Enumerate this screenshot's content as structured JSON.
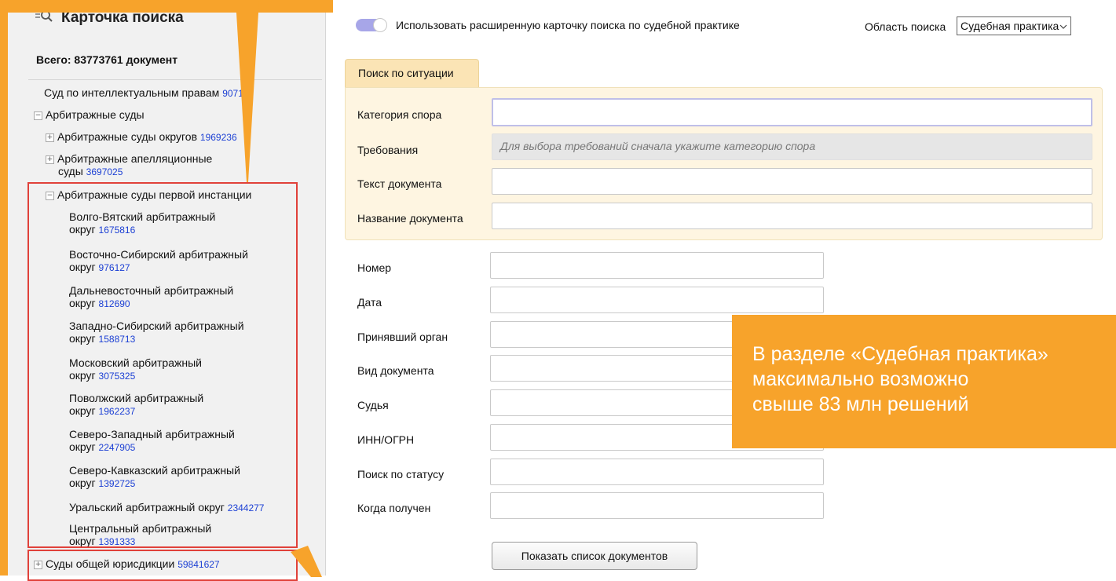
{
  "sidebar": {
    "title": "Карточка поиска",
    "total": "Всего: 83773761 документ",
    "items": [
      {
        "label": "Суд по интеллектуальным правам",
        "count": "90712"
      },
      {
        "label": "Арбитражные суды",
        "count": ""
      },
      {
        "label": "Арбитражные суды округов",
        "count": "1969236"
      },
      {
        "label": "Арбитражные апелляционные",
        "label2": "суды",
        "count": "3697025"
      },
      {
        "label": "Арбитражные суды первой инстанции",
        "count": ""
      },
      {
        "label": "Волго-Вятский арбитражный",
        "label2": "округ",
        "count": "1675816"
      },
      {
        "label": "Восточно-Сибирский арбитражный",
        "label2": "округ",
        "count": "976127"
      },
      {
        "label": "Дальневосточный арбитражный",
        "label2": "округ",
        "count": "812690"
      },
      {
        "label": "Западно-Сибирский арбитражный",
        "label2": "округ",
        "count": "1588713"
      },
      {
        "label": "Московский арбитражный",
        "label2": "округ",
        "count": "3075325"
      },
      {
        "label": "Поволжский арбитражный",
        "label2": "округ",
        "count": "1962237"
      },
      {
        "label": "Северо-Западный арбитражный",
        "label2": "округ",
        "count": "2247905"
      },
      {
        "label": "Северо-Кавказский арбитражный",
        "label2": "округ",
        "count": "1392725"
      },
      {
        "label": "Уральский арбитражный округ",
        "count": "2344277"
      },
      {
        "label": "Центральный арбитражный",
        "label2": "округ",
        "count": "1391333"
      },
      {
        "label": "Суды общей юрисдикции",
        "count": "59841627"
      }
    ]
  },
  "header": {
    "toggle_label": "Использовать расширенную карточку поиска по судебной практике",
    "scope_label": "Область поиска",
    "scope_value": "Судебная практика"
  },
  "situation": {
    "tab_label": "Поиск по ситуации",
    "fields": {
      "category_label": "Категория спора",
      "requirements_label": "Требования",
      "requirements_placeholder": "Для выбора требований сначала укажите категорию спора",
      "text_label": "Текст документа",
      "title_label": "Название документа"
    }
  },
  "form": {
    "number_label": "Номер",
    "date_label": "Дата",
    "authority_label": "Принявший орган",
    "doctype_label": "Вид документа",
    "judge_label": "Судья",
    "inn_label": "ИНН/ОГРН",
    "status_label": "Поиск по статусу",
    "received_label": "Когда получен",
    "submit_label": "Показать список документов"
  },
  "callout": {
    "line1": "В разделе «Судебная практика»",
    "line2": "максимально возможно",
    "line3": "свыше 83 млн решений"
  },
  "colors": {
    "accent_orange": "#f7a32b",
    "highlight_red": "#e0413a",
    "link_blue": "#1b3fd4",
    "toggle_purple": "#a7a6e8"
  }
}
